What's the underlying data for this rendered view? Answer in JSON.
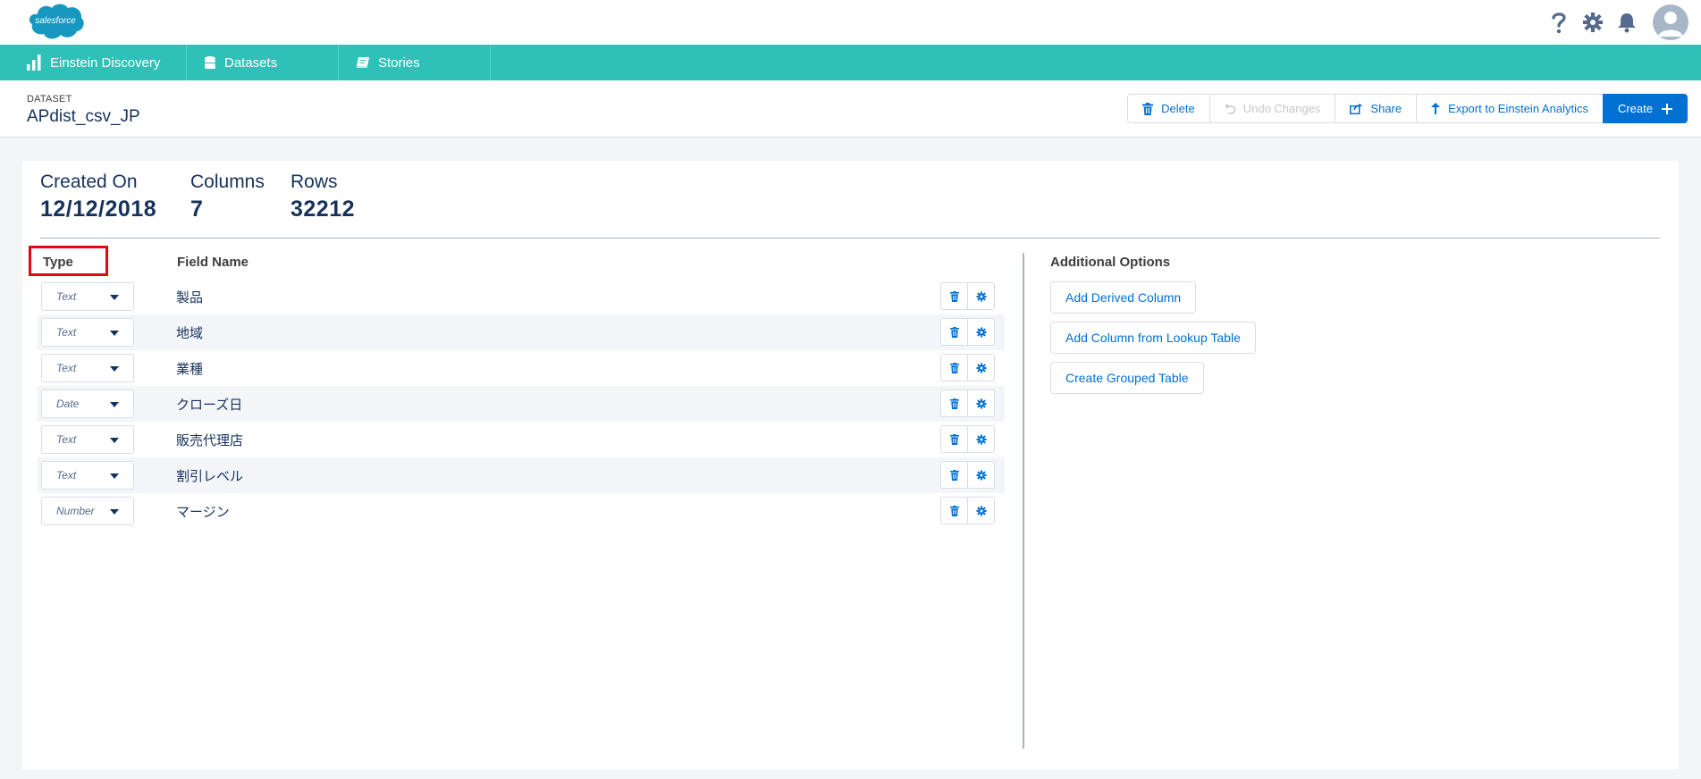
{
  "header": {
    "logo_text": "salesforce",
    "icons": [
      "help-icon",
      "setup-gear-icon",
      "notifications-bell-icon",
      "user-avatar"
    ]
  },
  "nav": {
    "tabs": [
      {
        "label": "Einstein Discovery",
        "icon": "bar-chart-icon"
      },
      {
        "label": "Datasets",
        "icon": "database-icon"
      },
      {
        "label": "Stories",
        "icon": "book-icon"
      }
    ]
  },
  "page": {
    "eyebrow": "DATASET",
    "title": "APdist_csv_JP",
    "actions": {
      "delete": "Delete",
      "undo": "Undo Changes",
      "share": "Share",
      "export": "Export to Einstein Analytics",
      "create": "Create"
    }
  },
  "stats": {
    "created_label": "Created On",
    "created_value": "12/12/2018",
    "columns_label": "Columns",
    "columns_value": "7",
    "rows_label": "Rows",
    "rows_value": "32212"
  },
  "table": {
    "type_header": "Type",
    "field_header": "Field Name",
    "rows": [
      {
        "type": "Text",
        "name": "製品"
      },
      {
        "type": "Text",
        "name": "地域"
      },
      {
        "type": "Text",
        "name": "業種"
      },
      {
        "type": "Date",
        "name": "クローズ日"
      },
      {
        "type": "Text",
        "name": "販売代理店"
      },
      {
        "type": "Text",
        "name": "割引レベル"
      },
      {
        "type": "Number",
        "name": "マージン"
      }
    ]
  },
  "options": {
    "heading": "Additional Options",
    "derived": "Add Derived Column",
    "lookup": "Add Column from Lookup Table",
    "grouped": "Create Grouped Table"
  },
  "colors": {
    "nav": "#2fc1b8",
    "brand": "#0070d2",
    "highlight": "#e30613"
  }
}
